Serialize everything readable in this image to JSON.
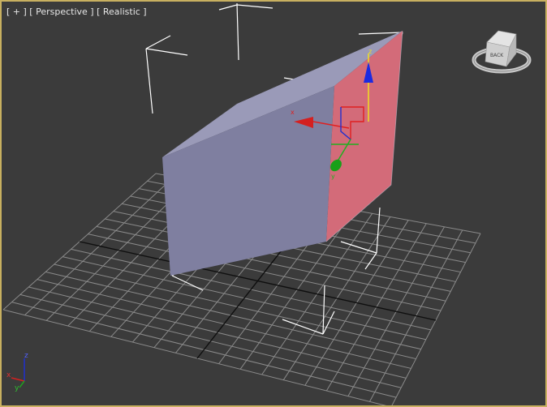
{
  "viewport": {
    "label_plus": "[ + ]",
    "label_view": "[ Perspective ]",
    "label_shading": "[ Realistic ]"
  },
  "viewcube": {
    "face_label": "BACK"
  },
  "gizmo": {
    "x_label": "x",
    "z_label": "z",
    "y_label": "y"
  },
  "axis_tripod": {
    "x_label": "x",
    "y_label": "y",
    "z_label": "z"
  },
  "colors": {
    "viewport_bg": "#3b3b3b",
    "active_border": "#c8b060",
    "object_light": "#9a9ab8",
    "object_dark": "#7f7fa0",
    "selected_face": "#d36b79",
    "x_axis": "#d42020",
    "y_axis": "#20a020",
    "z_axis": "#2030d0",
    "gizmo_yellow": "#f0e020"
  },
  "icons": [
    "viewcube-icon",
    "transform-gizmo-icon",
    "axis-tripod-icon"
  ]
}
